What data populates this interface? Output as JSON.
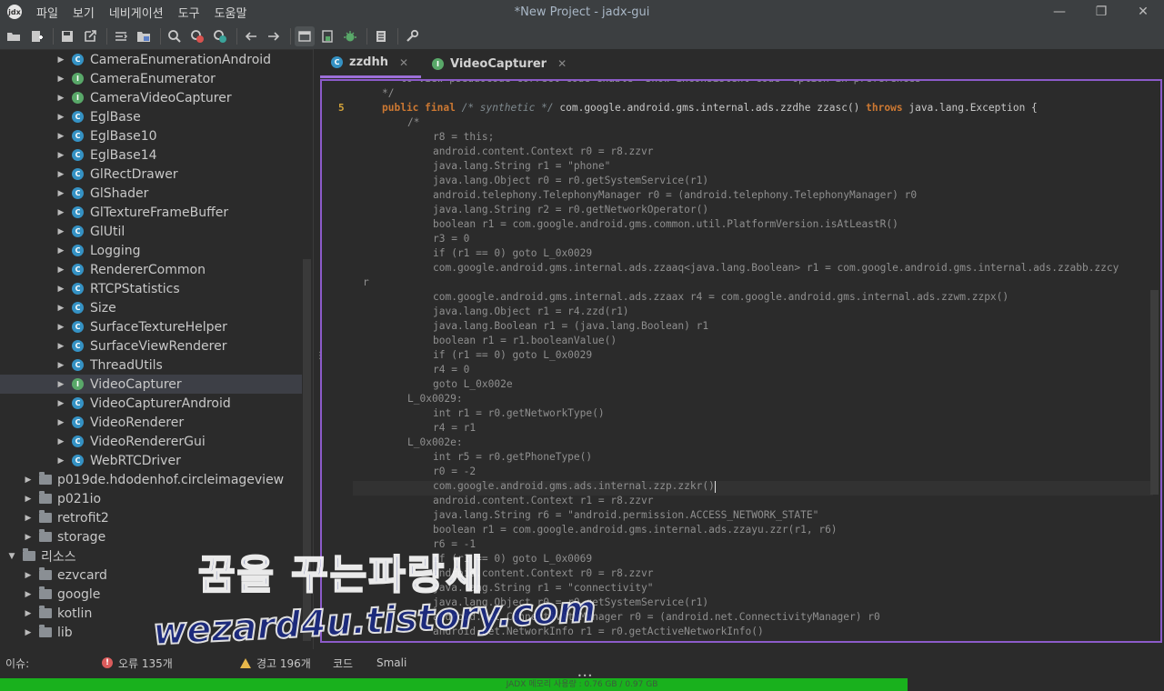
{
  "window": {
    "title": "*New Project - jadx-gui",
    "logo_text": "jdx",
    "controls": [
      "—",
      "❐",
      "✕"
    ]
  },
  "menu": [
    "파일",
    "보기",
    "네비게이션",
    "도구",
    "도움말"
  ],
  "toolbar": {
    "icons": [
      "open-folder-icon",
      "add-files-icon",
      "save-icon",
      "export-icon",
      "sync-icon",
      "flatten-packages-icon",
      "search-icon",
      "search-class-icon",
      "search-usage-icon",
      "back-icon",
      "forward-icon",
      "quick-tabs-icon",
      "deobfuscation-icon",
      "debug-icon",
      "log-icon",
      "preferences-icon"
    ]
  },
  "tree": {
    "items": [
      {
        "label": "CameraEnumerationAndroid",
        "kind": "class",
        "depth": 2
      },
      {
        "label": "CameraEnumerator",
        "kind": "interface",
        "depth": 2
      },
      {
        "label": "CameraVideoCapturer",
        "kind": "interface",
        "depth": 2
      },
      {
        "label": "EglBase",
        "kind": "class",
        "depth": 2
      },
      {
        "label": "EglBase10",
        "kind": "class",
        "depth": 2
      },
      {
        "label": "EglBase14",
        "kind": "class",
        "depth": 2
      },
      {
        "label": "GlRectDrawer",
        "kind": "class",
        "depth": 2
      },
      {
        "label": "GlShader",
        "kind": "class",
        "depth": 2
      },
      {
        "label": "GlTextureFrameBuffer",
        "kind": "class",
        "depth": 2
      },
      {
        "label": "GlUtil",
        "kind": "class",
        "depth": 2
      },
      {
        "label": "Logging",
        "kind": "class",
        "depth": 2
      },
      {
        "label": "RendererCommon",
        "kind": "class",
        "depth": 2
      },
      {
        "label": "RTCPStatistics",
        "kind": "class",
        "depth": 2
      },
      {
        "label": "Size",
        "kind": "class",
        "depth": 2
      },
      {
        "label": "SurfaceTextureHelper",
        "kind": "class",
        "depth": 2
      },
      {
        "label": "SurfaceViewRenderer",
        "kind": "class",
        "depth": 2
      },
      {
        "label": "ThreadUtils",
        "kind": "class",
        "depth": 2
      },
      {
        "label": "VideoCapturer",
        "kind": "interface",
        "depth": 2,
        "selected": true
      },
      {
        "label": "VideoCapturerAndroid",
        "kind": "class",
        "depth": 2
      },
      {
        "label": "VideoRenderer",
        "kind": "class",
        "depth": 2
      },
      {
        "label": "VideoRendererGui",
        "kind": "class",
        "depth": 2
      },
      {
        "label": "WebRTCDriver",
        "kind": "class",
        "depth": 2
      },
      {
        "label": "p019de.hdodenhof.circleimageview",
        "kind": "package",
        "depth": 1
      },
      {
        "label": "p021io",
        "kind": "package",
        "depth": 1
      },
      {
        "label": "retrofit2",
        "kind": "package",
        "depth": 1
      },
      {
        "label": "storage",
        "kind": "package",
        "depth": 1
      },
      {
        "label": "리소스",
        "kind": "folder",
        "depth": 0,
        "expanded": true
      },
      {
        "label": "ezvcard",
        "kind": "folder",
        "depth": 1
      },
      {
        "label": "google",
        "kind": "folder",
        "depth": 1
      },
      {
        "label": "kotlin",
        "kind": "folder",
        "depth": 1
      },
      {
        "label": "lib",
        "kind": "folder",
        "depth": 1
      }
    ]
  },
  "tabs": [
    {
      "label": "zzdhh",
      "icon": "C",
      "active": true
    },
    {
      "label": "VideoCapturer",
      "icon": "I",
      "active": false
    }
  ],
  "code": {
    "lines": [
      {
        "no": "",
        "indent": 0,
        "text": "   to view pseudocode correct code enable \"Show inconsistent code\" option in preferences",
        "type": "comment"
      },
      {
        "no": "",
        "indent": 0,
        "text": "*/",
        "type": "comment"
      },
      {
        "no": "5",
        "indent": 0,
        "text": "",
        "type": "signature"
      },
      {
        "no": "",
        "indent": 4,
        "text": "/*",
        "type": "comment"
      },
      {
        "no": "",
        "indent": 8,
        "text": "r8 = this;",
        "type": "code"
      },
      {
        "no": "",
        "indent": 8,
        "text": "android.content.Context r0 = r8.zzvr",
        "type": "code"
      },
      {
        "no": "",
        "indent": 8,
        "text": "java.lang.String r1 = \"phone\"",
        "type": "code"
      },
      {
        "no": "",
        "indent": 8,
        "text": "java.lang.Object r0 = r0.getSystemService(r1)",
        "type": "code"
      },
      {
        "no": "",
        "indent": 8,
        "text": "android.telephony.TelephonyManager r0 = (android.telephony.TelephonyManager) r0",
        "type": "code"
      },
      {
        "no": "",
        "indent": 8,
        "text": "java.lang.String r2 = r0.getNetworkOperator()",
        "type": "code"
      },
      {
        "no": "",
        "indent": 8,
        "text": "boolean r1 = com.google.android.gms.common.util.PlatformVersion.isAtLeastR()",
        "type": "code"
      },
      {
        "no": "",
        "indent": 8,
        "text": "r3 = 0",
        "type": "code"
      },
      {
        "no": "",
        "indent": 8,
        "text": "if (r1 == 0) goto L_0x0029",
        "type": "code"
      },
      {
        "no": "",
        "indent": 8,
        "text": "com.google.android.gms.internal.ads.zzaaq<java.lang.Boolean> r1 = com.google.android.gms.internal.ads.zzabb.zzcy",
        "type": "code"
      },
      {
        "no": "",
        "indent": -3,
        "text": "r",
        "type": "code"
      },
      {
        "no": "",
        "indent": 8,
        "text": "com.google.android.gms.internal.ads.zzaax r4 = com.google.android.gms.internal.ads.zzwm.zzpx()",
        "type": "code"
      },
      {
        "no": "",
        "indent": 8,
        "text": "java.lang.Object r1 = r4.zzd(r1)",
        "type": "code"
      },
      {
        "no": "",
        "indent": 8,
        "text": "java.lang.Boolean r1 = (java.lang.Boolean) r1",
        "type": "code"
      },
      {
        "no": "",
        "indent": 8,
        "text": "boolean r1 = r1.booleanValue()",
        "type": "code"
      },
      {
        "no": "",
        "indent": 8,
        "text": "if (r1 == 0) goto L_0x0029",
        "type": "code"
      },
      {
        "no": "",
        "indent": 8,
        "text": "r4 = 0",
        "type": "code"
      },
      {
        "no": "",
        "indent": 8,
        "text": "goto L_0x002e",
        "type": "code"
      },
      {
        "no": "",
        "indent": 4,
        "text": "L_0x0029:",
        "type": "code"
      },
      {
        "no": "",
        "indent": 8,
        "text": "int r1 = r0.getNetworkType()",
        "type": "code"
      },
      {
        "no": "",
        "indent": 8,
        "text": "r4 = r1",
        "type": "code"
      },
      {
        "no": "",
        "indent": 4,
        "text": "L_0x002e:",
        "type": "code"
      },
      {
        "no": "",
        "indent": 8,
        "text": "int r5 = r0.getPhoneType()",
        "type": "code"
      },
      {
        "no": "",
        "indent": 8,
        "text": "r0 = -2",
        "type": "code"
      },
      {
        "no": "",
        "indent": 8,
        "text": "com.google.android.gms.ads.internal.zzp.zzkr()",
        "type": "code",
        "current": true
      },
      {
        "no": "",
        "indent": 8,
        "text": "android.content.Context r1 = r8.zzvr",
        "type": "code"
      },
      {
        "no": "",
        "indent": 8,
        "text": "java.lang.String r6 = \"android.permission.ACCESS_NETWORK_STATE\"",
        "type": "code"
      },
      {
        "no": "",
        "indent": 8,
        "text": "boolean r1 = com.google.android.gms.internal.ads.zzayu.zzr(r1, r6)",
        "type": "code"
      },
      {
        "no": "",
        "indent": 8,
        "text": "r6 = -1",
        "type": "code"
      },
      {
        "no": "",
        "indent": 8,
        "text": "if (r1 == 0) goto L_0x0069",
        "type": "code"
      },
      {
        "no": "",
        "indent": 8,
        "text": "android.content.Context r0 = r8.zzvr",
        "type": "code"
      },
      {
        "no": "",
        "indent": 8,
        "text": "java.lang.String r1 = \"connectivity\"",
        "type": "code"
      },
      {
        "no": "",
        "indent": 8,
        "text": "java.lang.Object r0 = r0.getSystemService(r1)",
        "type": "code"
      },
      {
        "no": "",
        "indent": 8,
        "text": "android.net.ConnectivityManager r0 = (android.net.ConnectivityManager) r0",
        "type": "code"
      },
      {
        "no": "",
        "indent": 8,
        "text": "android.net.NetworkInfo r1 = r0.getActiveNetworkInfo()",
        "type": "code"
      }
    ],
    "signature": {
      "kw1": "public final",
      "comment": "/* synthetic */",
      "rest": "com.google.android.gms.internal.ads.zzdhe zzasc()",
      "kw2": "throws",
      "tail": "java.lang.Exception {"
    }
  },
  "status": {
    "label": "이슈:",
    "errors": "오류 135개",
    "warnings": "경고 196개",
    "code_tab": "코드",
    "smali_tab": "Smali",
    "memory_text": "JADX 메모리 사용량 : 0.76 GB / 0.97 GB",
    "memory_used_fraction": 0.78,
    "accent_color": "#19b11d"
  },
  "watermark": {
    "line1": "꿈을 꾸는파랑새",
    "line2": "wezard4u.tistory.com"
  }
}
